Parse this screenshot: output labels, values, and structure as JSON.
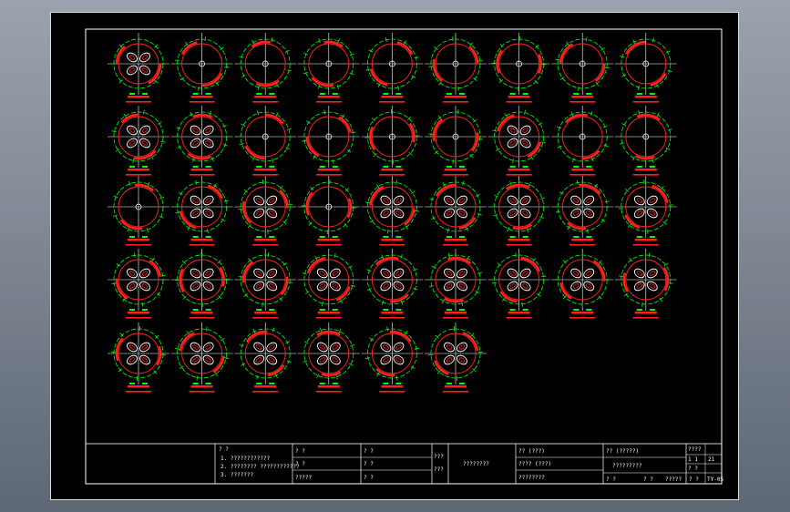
{
  "drawing": {
    "colors": {
      "background": "#000000",
      "frame": "#ffffff",
      "circle": "#ffffff",
      "ring": "#00ff00",
      "arc": "#ff2020",
      "dimension": "#00ff00"
    },
    "grid": [
      [
        1,
        0,
        0,
        0,
        0,
        0,
        0,
        0,
        0
      ],
      [
        1,
        1,
        0,
        0,
        0,
        0,
        1,
        0,
        0
      ],
      [
        0,
        1,
        1,
        0,
        1,
        1,
        1,
        1,
        1
      ],
      [
        1,
        1,
        1,
        1,
        1,
        1,
        1,
        1,
        1
      ],
      [
        1,
        1,
        1,
        1,
        1,
        1
      ]
    ],
    "title_block": {
      "notes": [
        "? ?",
        "1. ????????????",
        "2. ???????? ????????????",
        "3. ???????"
      ],
      "cells": [
        "? ?",
        "? ?",
        "?????",
        "? ?",
        "? ?",
        "? ?",
        "???",
        "???",
        "????????",
        "?? (???)",
        "???? (???)",
        "????????",
        "?? (?????)",
        "?????????",
        "????",
        "1 1",
        "? ?",
        "? ?",
        "? ?",
        "?????",
        "? ?",
        "TY-05",
        "21"
      ]
    }
  }
}
